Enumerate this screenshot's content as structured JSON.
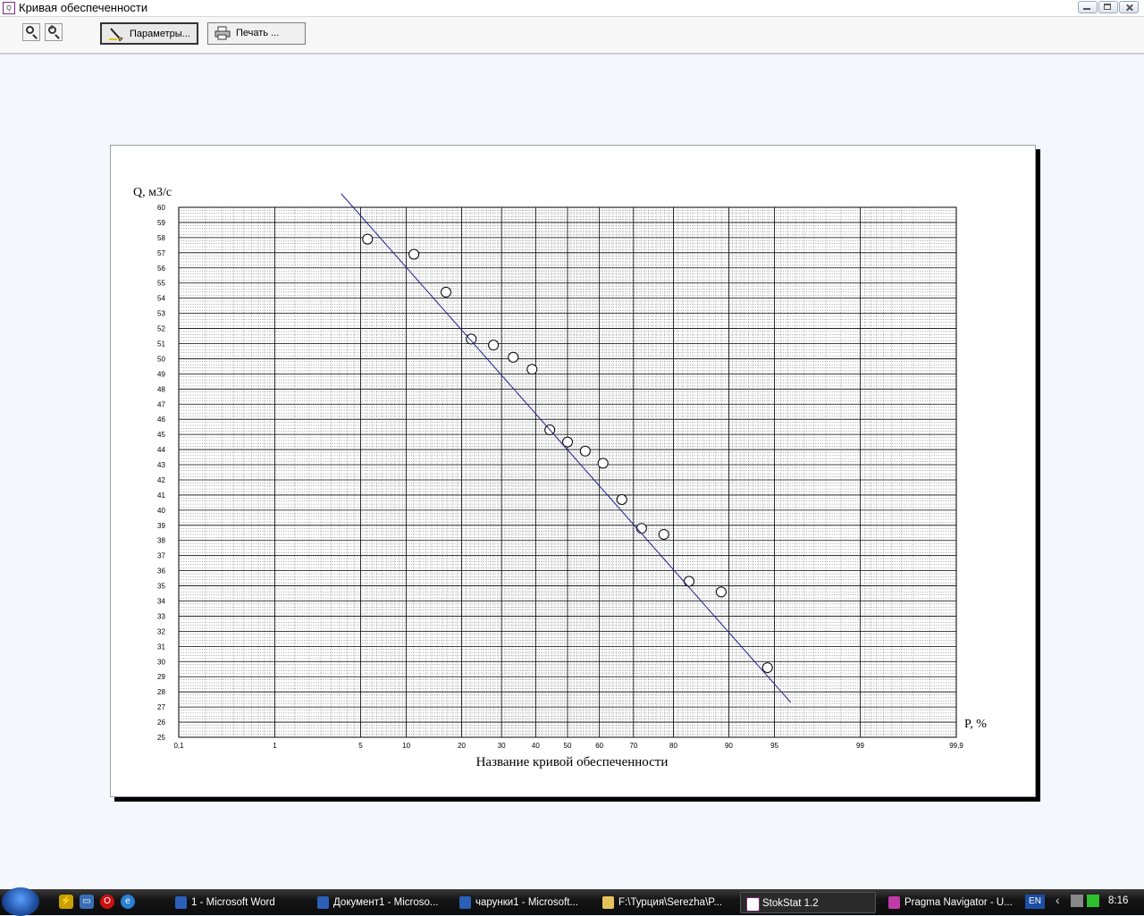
{
  "window": {
    "title": "Кривая обеспеченности",
    "app_icon_text": "Q P"
  },
  "toolbar": {
    "zoom_out_sign": "−",
    "zoom_in_sign": "+",
    "params_label": "Параметры...",
    "print_label": "Печать ..."
  },
  "chart_data": {
    "type": "scatter",
    "title": "Название кривой обеспеченности",
    "ylabel": "Q, м3/с",
    "xlabel": "P, %",
    "x_scale": "probability",
    "grid": true,
    "ylim": [
      25,
      60
    ],
    "y_ticks": [
      25,
      26,
      27,
      28,
      29,
      30,
      31,
      32,
      33,
      34,
      35,
      36,
      37,
      38,
      39,
      40,
      41,
      42,
      43,
      44,
      45,
      46,
      47,
      48,
      49,
      50,
      51,
      52,
      53,
      54,
      55,
      56,
      57,
      58,
      59,
      60
    ],
    "x_ticks": [
      0.1,
      1,
      5,
      10,
      20,
      30,
      40,
      50,
      60,
      70,
      80,
      90,
      95,
      99,
      99.9
    ],
    "x_tick_labels": [
      "0,1",
      "1",
      "5",
      "10",
      "20",
      "30",
      "40",
      "50",
      "60",
      "70",
      "80",
      "90",
      "95",
      "99",
      "99,9"
    ],
    "series": [
      {
        "kind": "points",
        "points": [
          [
            5.6,
            57.9
          ],
          [
            11.1,
            56.9
          ],
          [
            16.7,
            54.4
          ],
          [
            22.2,
            51.3
          ],
          [
            27.8,
            50.9
          ],
          [
            33.3,
            50.1
          ],
          [
            38.9,
            49.3
          ],
          [
            44.4,
            45.3
          ],
          [
            50.0,
            44.5
          ],
          [
            55.6,
            43.9
          ],
          [
            61.1,
            43.1
          ],
          [
            66.7,
            40.7
          ],
          [
            72.2,
            38.8
          ],
          [
            77.8,
            38.4
          ],
          [
            83.3,
            35.3
          ],
          [
            88.9,
            34.6
          ],
          [
            94.4,
            29.6
          ]
        ]
      },
      {
        "kind": "line",
        "points": [
          [
            3.6,
            60.9
          ],
          [
            96.2,
            27.3
          ]
        ]
      }
    ],
    "colors": {
      "points": "#000000",
      "line": "#1f1f8f",
      "grid": "#000000"
    }
  },
  "taskbar": {
    "items": [
      "1 - Microsoft Word",
      "Документ1 - Microso...",
      "чарунки1 - Microsoft...",
      "F:\\Турция\\Serezha\\P...",
      "StokStat 1.2",
      "Pragma Navigator - U..."
    ],
    "lang": "EN",
    "clock": "8:16"
  }
}
